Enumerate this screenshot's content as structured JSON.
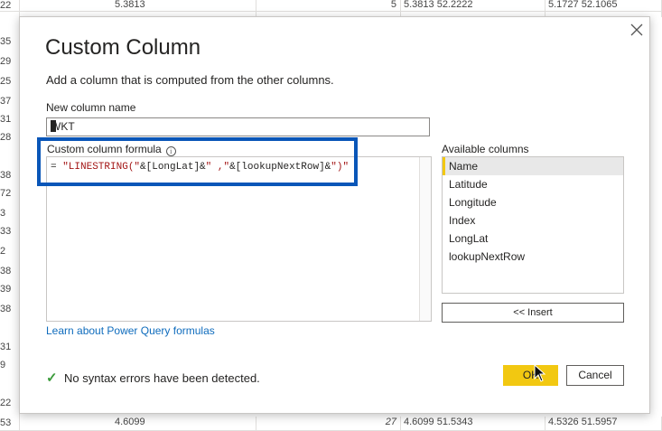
{
  "background": {
    "top_row": [
      "5.3813",
      "5",
      "5.3813 52.2222",
      "5.1727 52.1065"
    ],
    "bottom_row": [
      "4.6099",
      "27",
      "4.6099 51.5343",
      "4.5326 51.5957"
    ],
    "left_numbers": [
      "22",
      "35",
      "29",
      "25",
      "37",
      "31",
      "28",
      "38",
      "72",
      "3",
      "33",
      "2",
      "38",
      "39",
      "38",
      "31",
      "9",
      "22",
      "53"
    ]
  },
  "dialog": {
    "title": "Custom Column",
    "close_icon": "close-icon",
    "subtitle": "Add a column that is computed from the other columns.",
    "new_column_label": "New column name",
    "new_column_value": "WKT",
    "formula_label": "Custom column formula",
    "info_icon": "info-icon",
    "formula_prefix": "= ",
    "formula_parts": {
      "p1": "\"LINESTRING(\"",
      "p2": "&[LongLat]&",
      "p3": "\" ,\"",
      "p4": "&[lookupNextRow]&",
      "p5": "\")\""
    },
    "available_label": "Available columns",
    "available_columns": [
      "Name",
      "Latitude",
      "Longitude",
      "Index",
      "LongLat",
      "lookupNextRow"
    ],
    "insert_label": "<< Insert",
    "learn_link": "Learn about Power Query formulas",
    "status_text": "No syntax errors have been detected.",
    "ok_label": "OK",
    "cancel_label": "Cancel"
  },
  "colors": {
    "highlight": "#0a56b8",
    "ok_button": "#f2c811",
    "link": "#0f6cbd",
    "check": "#3a9b3a"
  }
}
